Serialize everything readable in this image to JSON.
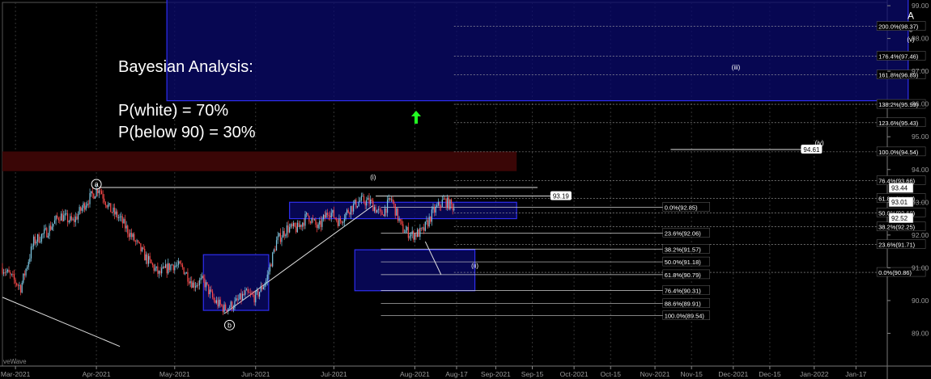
{
  "annotation": {
    "title": "Bayesian Analysis:",
    "p_white": "P(white) = 70%",
    "p_below": "P(below 90) = 30%"
  },
  "colors": {
    "background": "#000000",
    "candle_up": "#7ec8e3",
    "candle_down": "#ff4a4a",
    "blue_box": "#2e2ef0",
    "blue_fill": "#0a0a6e",
    "red_zone": "#3a0606",
    "fib_line": "#cfcfcf",
    "arrow": "#22ff22"
  },
  "chart_data": {
    "type": "candlestick",
    "x_labels": [
      "Mar-2021",
      "Apr-2021",
      "May-2021",
      "Jun-2021",
      "Jul-2021",
      "Aug-2021",
      "Aug-17",
      "Sep-2021",
      "Sep-15",
      "Oct-2021",
      "Oct-15",
      "Nov-2021",
      "Nov-15",
      "Dec-2021",
      "Dec-15",
      "Jan-2022",
      "Jan-17"
    ],
    "x_label_days": [
      0,
      31,
      61,
      92,
      122,
      153,
      169,
      184,
      198,
      214,
      228,
      245,
      259,
      275,
      289,
      306,
      322
    ],
    "x_range_days": [
      -5,
      334
    ],
    "y_ticks": [
      "89.00",
      "90.00",
      "91.00",
      "92.00",
      "93.00",
      "94.00",
      "95.00",
      "96.00",
      "97.00",
      "98.00",
      "99.00"
    ],
    "ylim": [
      88.0,
      99.1
    ],
    "price_path": [
      [
        -5,
        91.0
      ],
      [
        2,
        90.4
      ],
      [
        7,
        91.8
      ],
      [
        12,
        92.1
      ],
      [
        17,
        92.6
      ],
      [
        22,
        92.4
      ],
      [
        27,
        93.0
      ],
      [
        32,
        93.45
      ],
      [
        36,
        92.8
      ],
      [
        40,
        92.5
      ],
      [
        45,
        91.9
      ],
      [
        50,
        91.3
      ],
      [
        55,
        90.8
      ],
      [
        60,
        91.1
      ],
      [
        64,
        91.0
      ],
      [
        68,
        90.5
      ],
      [
        72,
        90.6
      ],
      [
        76,
        90.0
      ],
      [
        80,
        89.75
      ],
      [
        84,
        89.9
      ],
      [
        88,
        90.2
      ],
      [
        92,
        90.1
      ],
      [
        96,
        90.6
      ],
      [
        100,
        91.8
      ],
      [
        104,
        92.2
      ],
      [
        108,
        92.2
      ],
      [
        112,
        92.6
      ],
      [
        116,
        92.2
      ],
      [
        120,
        92.75
      ],
      [
        124,
        92.4
      ],
      [
        128,
        92.8
      ],
      [
        132,
        93.05
      ],
      [
        136,
        93.0
      ],
      [
        140,
        92.6
      ],
      [
        144,
        93.1
      ],
      [
        148,
        92.2
      ],
      [
        152,
        92.0
      ],
      [
        156,
        92.1
      ],
      [
        160,
        92.7
      ],
      [
        164,
        93.05
      ],
      [
        168,
        92.85
      ]
    ],
    "blue_boxes": [
      {
        "x": [
          105,
          192
        ],
        "y": [
          92.5,
          93.0
        ]
      },
      {
        "x": [
          72,
          97
        ],
        "y": [
          89.7,
          91.4
        ]
      },
      {
        "x": [
          130,
          176
        ],
        "y": [
          90.3,
          91.55
        ]
      },
      {
        "x": [
          58,
          342
        ],
        "y": [
          96.1,
          99.2
        ]
      }
    ],
    "red_zone": {
      "x": [
        -5,
        192
      ],
      "y": [
        93.95,
        94.55
      ]
    },
    "trend_lines": [
      {
        "from": [
          32,
          93.45
        ],
        "to": [
          200,
          93.45
        ]
      },
      {
        "from": [
          80,
          89.6
        ],
        "to": [
          137,
          92.9
        ]
      },
      {
        "from": [
          -5,
          90.1
        ],
        "to": [
          40,
          88.6
        ]
      },
      {
        "from": [
          157,
          91.8
        ],
        "to": [
          163,
          90.8
        ]
      }
    ],
    "resistance_lines": [
      {
        "x": [
          138,
          213
        ],
        "y": 93.19,
        "label": "93.19"
      },
      {
        "x": [
          251,
          309
        ],
        "y": 94.61,
        "label": "94.61"
      }
    ],
    "wave_labels": [
      {
        "text": "a",
        "x": 31,
        "y": 93.55,
        "circled": true
      },
      {
        "text": "b",
        "x": 82,
        "y": 89.25,
        "circled": true
      },
      {
        "text": "(i)",
        "x": 137,
        "y": 93.7
      },
      {
        "text": "(ii)",
        "x": 176,
        "y": 91.0
      },
      {
        "text": "(iii)",
        "x": 276,
        "y": 97.05
      },
      {
        "text": "(iv)",
        "x": 308,
        "y": 94.75
      },
      {
        "text": "(v)",
        "x": 343,
        "y": 97.9
      },
      {
        "text": "c",
        "x": 343,
        "y": 98.2
      },
      {
        "text": "A",
        "x": 343,
        "y": 98.6
      }
    ],
    "fib_upper": [
      {
        "label": "200.0%(98.37)",
        "y": 98.37
      },
      {
        "label": "176.4%(97.46)",
        "y": 97.46
      },
      {
        "label": "161.8%(96.89)",
        "y": 96.89
      },
      {
        "label": "138.2%(95.99)",
        "y": 95.99
      },
      {
        "label": "123.6%(95.43)",
        "y": 95.43
      },
      {
        "label": "100.0%(94.54)",
        "y": 94.54
      },
      {
        "label": "76.4%(93.66)",
        "y": 93.66
      },
      {
        "label": "61.8%(93.12)",
        "y": 93.12
      },
      {
        "label": "50.0%(92.68)",
        "y": 92.68
      },
      {
        "label": "38.2%(92.25)",
        "y": 92.25
      },
      {
        "label": "23.6%(91.71)",
        "y": 91.71
      },
      {
        "label": "0.0%(90.86)",
        "y": 90.86
      }
    ],
    "fib_lower": [
      {
        "label": "0.0%(92.85)",
        "y": 92.85
      },
      {
        "label": "23.6%(92.06)",
        "y": 92.06
      },
      {
        "label": "38.2%(91.57)",
        "y": 91.57
      },
      {
        "label": "50.0%(91.18)",
        "y": 91.18
      },
      {
        "label": "61.8%(90.79)",
        "y": 90.79
      },
      {
        "label": "76.4%(90.31)",
        "y": 90.31
      },
      {
        "label": "88.6%(89.91)",
        "y": 89.91
      },
      {
        "label": "100.0%(89.54)",
        "y": 89.54
      }
    ],
    "price_tags": [
      {
        "label": "93.44",
        "y": 93.44
      },
      {
        "label": "93.01",
        "y": 93.01
      },
      {
        "label": "92.52",
        "y": 92.52
      }
    ],
    "watermark": "veWave"
  }
}
